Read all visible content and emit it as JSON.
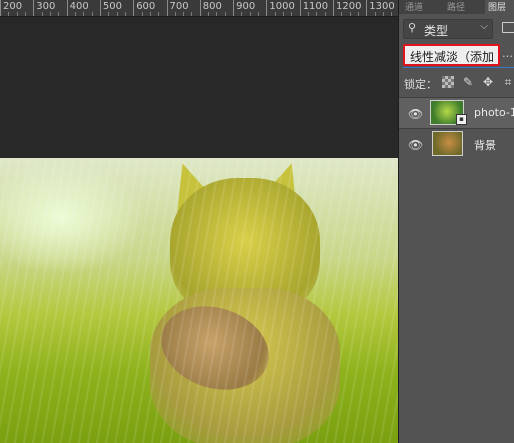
{
  "ruler": {
    "labels": [
      "200",
      "300",
      "400",
      "500",
      "600",
      "700",
      "800",
      "900",
      "1000",
      "1100",
      "1200",
      "1300"
    ]
  },
  "panel": {
    "tabs": [
      "通道",
      "路径",
      "图层"
    ],
    "filter": {
      "icon": "search-icon",
      "label": "类型"
    },
    "blend_mode": {
      "value": "线性减淡（添加",
      "ext": "…"
    },
    "lock": {
      "label": "锁定："
    },
    "layers": [
      {
        "name": "photo-1",
        "visible": true,
        "smart_object": true
      },
      {
        "name": "背景",
        "visible": true,
        "smart_object": false
      }
    ]
  },
  "colors": {
    "panel_bg": "#535353",
    "highlight_border": "#e3131b",
    "canvas_bg": "#282828"
  }
}
